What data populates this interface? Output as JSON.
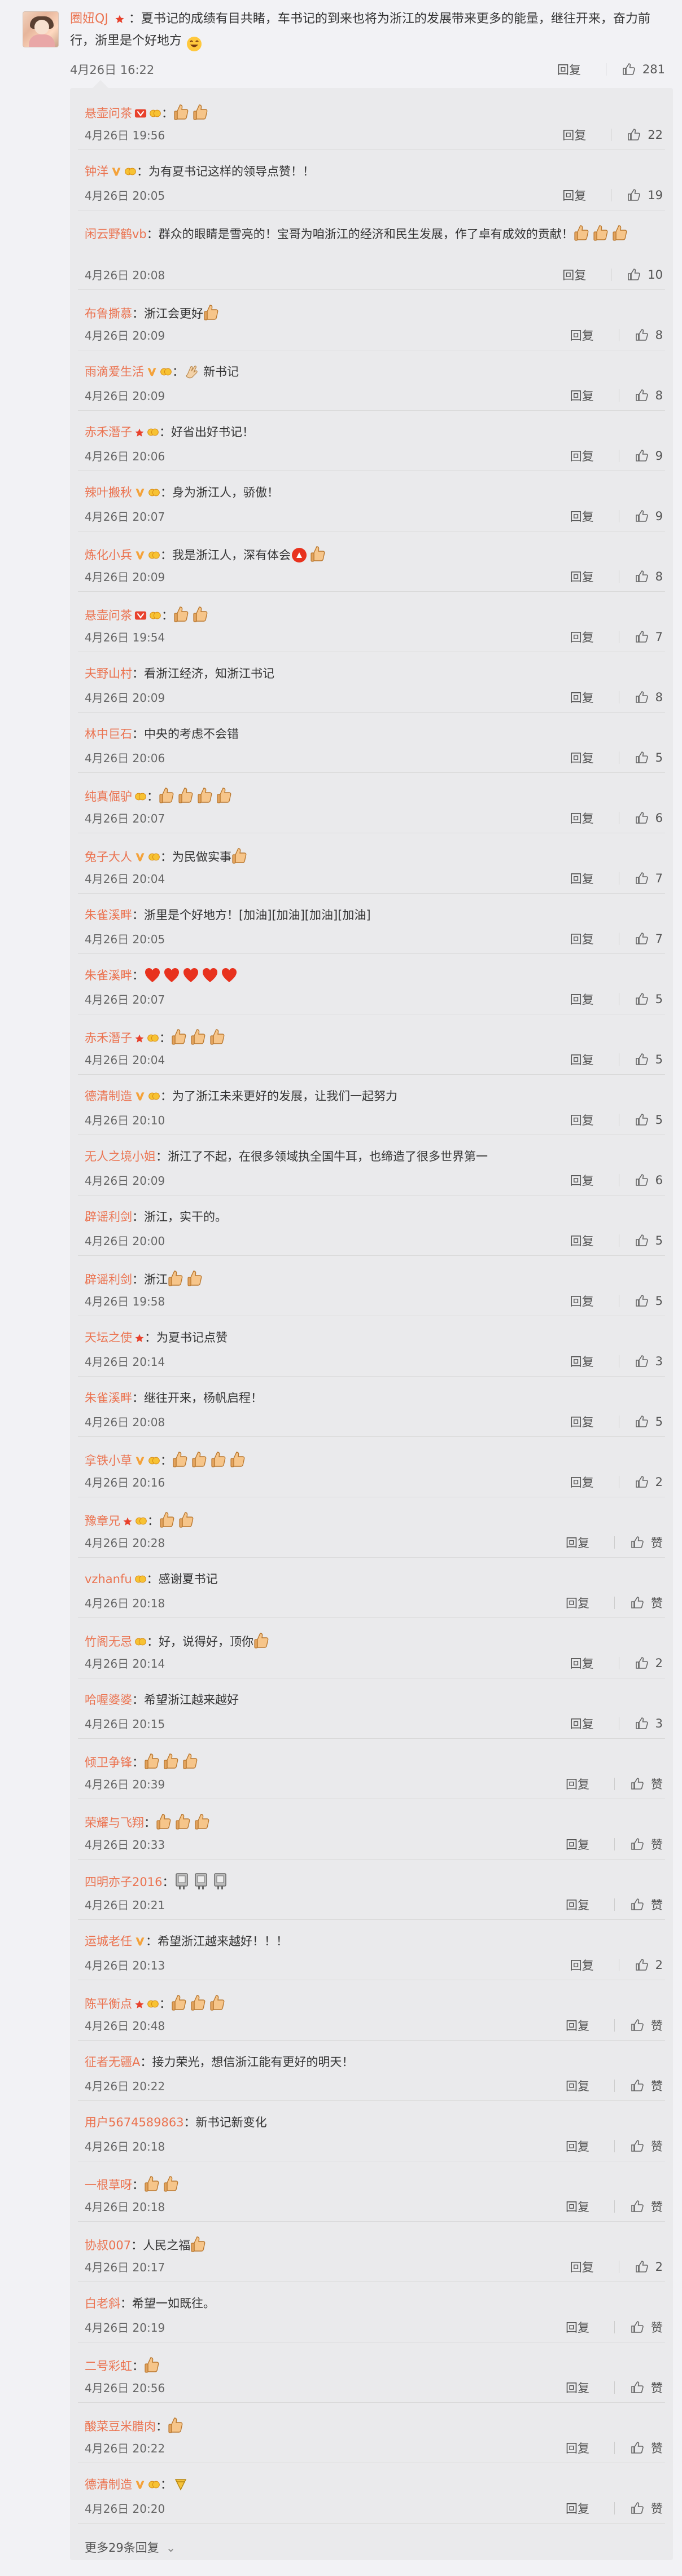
{
  "main_comment": {
    "username": "圈妞QJ",
    "text": "：夏书记的成绩有目共睹，车书记的到来也将为浙江的发展带来更多的能量，继往开来，奋力前行，浙里是个好地方",
    "time": "4月26日 16:22",
    "reply_label": "回复",
    "likes": "281"
  },
  "replies": [
    {
      "user": "悬壶问茶",
      "text": "：",
      "time": "4月26日 19:56",
      "likes": "22"
    },
    {
      "user": "钟洋",
      "text": "：为有夏书记这样的领导点赞！！",
      "time": "4月26日 20:05",
      "likes": "19"
    },
    {
      "user": "闲云野鹤vb",
      "text": "：群众的眼睛是雪亮的！宝哥为咱浙江的经济和民生发展，作了卓有成效的贡献！",
      "time": "4月26日 20:08",
      "likes": "10"
    },
    {
      "user": "布鲁撕慕",
      "text": "：浙江会更好",
      "time": "4月26日 20:09",
      "likes": "8"
    },
    {
      "user": "雨滴爱生活",
      "text": "：新书记",
      "time": "4月26日 20:09",
      "likes": "8"
    },
    {
      "user": "赤禾潛子",
      "text": "：好省出好书记！",
      "time": "4月26日 20:06",
      "likes": "9"
    },
    {
      "user": "辣叶搬秋",
      "text": "：身为浙江人，骄傲！",
      "time": "4月26日 20:07",
      "likes": "9"
    },
    {
      "user": "炼化小兵",
      "text": "：我是浙江人，深有体会",
      "time": "4月26日 20:09",
      "likes": "8"
    },
    {
      "user": "悬壶问茶",
      "text": "：",
      "time": "4月26日 19:54",
      "likes": "7"
    },
    {
      "user": "夫野山村",
      "text": "：看浙江经济，知浙江书记",
      "time": "4月26日 20:09",
      "likes": "8"
    },
    {
      "user": "林中巨石",
      "text": "：中央的考虑不会错",
      "time": "4月26日 20:06",
      "likes": "5"
    },
    {
      "user": "纯真倔驴",
      "text": "：",
      "time": "4月26日 20:07",
      "likes": "6"
    },
    {
      "user": "兔子大人",
      "text": "：为民做实事",
      "time": "4月26日 20:04",
      "likes": "7"
    },
    {
      "user": "朱雀溪畔",
      "text": "：浙里是个好地方！[加油][加油][加油][加油]",
      "time": "4月26日 20:05",
      "likes": "7"
    },
    {
      "user": "朱雀溪畔",
      "text": "：",
      "time": "4月26日 20:07",
      "likes": "5"
    },
    {
      "user": "赤禾潛子",
      "text": "：",
      "time": "4月26日 20:04",
      "likes": "5"
    },
    {
      "user": "德清制造",
      "text": "：为了浙江未来更好的发展，让我们一起努力",
      "time": "4月26日 20:10",
      "likes": "5"
    },
    {
      "user": "无人之境小姐",
      "text": "：浙江了不起，在很多领域执全国牛耳，也缔造了很多世界第一",
      "time": "4月26日 20:09",
      "likes": "6"
    },
    {
      "user": "辟谣利剑",
      "text": "：浙江，实干的。",
      "time": "4月26日 20:00",
      "likes": "5"
    },
    {
      "user": "辟谣利剑",
      "text": "：浙江",
      "time": "4月26日 19:58",
      "likes": "5"
    },
    {
      "user": "天坛之使",
      "text": "：为夏书记点赞",
      "time": "4月26日 20:14",
      "likes": "3"
    },
    {
      "user": "朱雀溪畔",
      "text": "：继往开来，杨帆启程！",
      "time": "4月26日 20:08",
      "likes": "5"
    },
    {
      "user": "拿铁小草",
      "text": "：",
      "time": "4月26日 20:16",
      "likes": "2"
    },
    {
      "user": "豫章兄",
      "text": "：",
      "time": "4月26日 20:28",
      "likes": "赞"
    },
    {
      "user": "vzhanfu",
      "text": "：感谢夏书记",
      "time": "4月26日 20:18",
      "likes": "赞"
    },
    {
      "user": "竹阁无忌",
      "text": "：好，说得好，顶你",
      "time": "4月26日 20:14",
      "likes": "2"
    },
    {
      "user": "哈喔婆婆",
      "text": "：希望浙江越来越好",
      "time": "4月26日 20:15",
      "likes": "3"
    },
    {
      "user": "倾卫争锋",
      "text": "：",
      "time": "4月26日 20:39",
      "likes": "赞"
    },
    {
      "user": "荣耀与飞翔",
      "text": "：",
      "time": "4月26日 20:33",
      "likes": "赞"
    },
    {
      "user": "四明亦子2016",
      "text": "：",
      "time": "4月26日 20:21",
      "likes": "赞"
    },
    {
      "user": "运城老任",
      "text": "：希望浙江越来越好！！！",
      "time": "4月26日 20:13",
      "likes": "2"
    },
    {
      "user": "陈平衡点",
      "text": "：",
      "time": "4月26日 20:48",
      "likes": "赞"
    },
    {
      "user": "征者无疆A",
      "text": "：接力荣光，想信浙江能有更好的明天！",
      "time": "4月26日 20:22",
      "likes": "赞"
    },
    {
      "user": "用户5674589863",
      "text": "：新书记新变化",
      "time": "4月26日 20:18",
      "likes": "赞"
    },
    {
      "user": "一根草呀",
      "text": "：",
      "time": "4月26日 20:18",
      "likes": "赞"
    },
    {
      "user": "协叔007",
      "text": "：人民之福",
      "time": "4月26日 20:17",
      "likes": "2"
    },
    {
      "user": "白老斜",
      "text": "：希望一如既往。",
      "time": "4月26日 20:19",
      "likes": "赞"
    },
    {
      "user": "二号彩虹",
      "text": "：",
      "time": "4月26日 20:56",
      "likes": "赞"
    },
    {
      "user": "酸菜豆米腊肉",
      "text": "：",
      "time": "4月26日 20:22",
      "likes": "赞"
    },
    {
      "user": "德清制造",
      "text": "：",
      "time": "4月26日 20:20",
      "likes": "赞"
    }
  ],
  "reply_label": "回复",
  "more_link": "更多29条回复",
  "colors": {
    "username": "#eb7350",
    "bg": "#f2f2f5",
    "panel": "#eaeaec",
    "text": "#333333",
    "meta": "#666666"
  }
}
